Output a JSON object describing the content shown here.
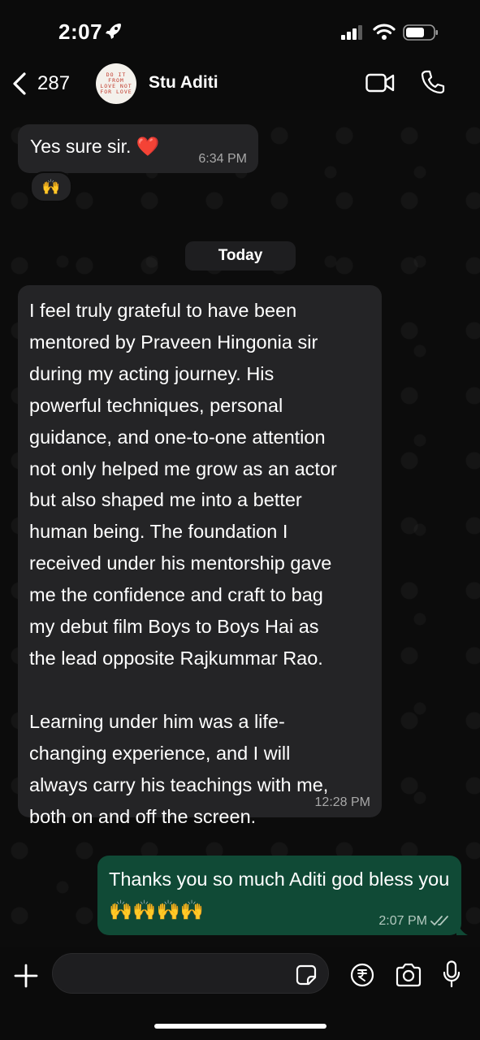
{
  "status_bar": {
    "time": "2:07"
  },
  "header": {
    "back_count": "287",
    "contact_name": "Stu Aditi",
    "avatar_text": "DO IT FROM LOVE NOT FOR LOVE"
  },
  "messages": [
    {
      "direction": "incoming",
      "text": "Yes sure sir. ❤️",
      "time": "6:34 PM",
      "reaction": "🙌"
    },
    {
      "direction": "incoming",
      "text": "I feel truly grateful to have been\nmentored by Praveen Hingonia sir\nduring my acting journey. His\npowerful techniques, personal\nguidance, and one-to-one attention\nnot only helped me grow as an actor\nbut also shaped me into a better\nhuman being. The foundation I\nreceived under his mentorship gave\nme the confidence and craft to bag\nmy debut film Boys to Boys Hai as\nthe lead opposite Rajkummar Rao.\n\nLearning under him was a life-\nchanging experience, and I will\nalways carry his teachings with me,\nboth on and off the screen.",
      "time": "12:28 PM"
    },
    {
      "direction": "outgoing",
      "text": "Thanks you so much Aditi god bless you 🙌🙌🙌🙌",
      "time": "2:07 PM",
      "status": "read"
    }
  ],
  "date_separator": "Today",
  "composer": {
    "placeholder": ""
  },
  "colors": {
    "incoming_bubble": "#242426",
    "outgoing_bubble": "#104a36",
    "background": "#0b0b0b"
  }
}
